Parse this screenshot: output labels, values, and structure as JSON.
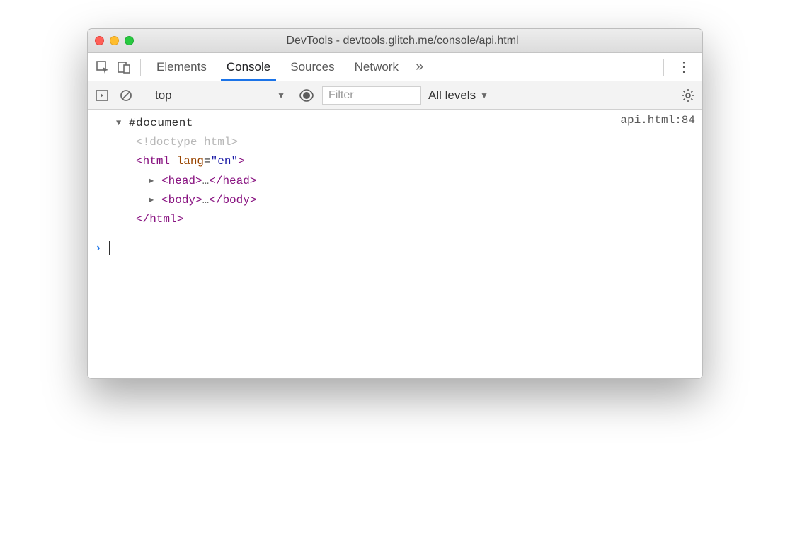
{
  "window": {
    "title": "DevTools - devtools.glitch.me/console/api.html"
  },
  "tabs": {
    "items": [
      "Elements",
      "Console",
      "Sources",
      "Network"
    ],
    "active_index": 1
  },
  "toolbar": {
    "context": "top",
    "filter_placeholder": "Filter",
    "levels_label": "All levels"
  },
  "log": {
    "source_link": "api.html:84",
    "root_label": "#document",
    "doctype": "<!doctype html>",
    "html_open": {
      "name": "html",
      "attr_name": "lang",
      "attr_value": "\"en\""
    },
    "head": {
      "name": "head"
    },
    "body": {
      "name": "body"
    },
    "html_close": {
      "name": "html"
    }
  }
}
